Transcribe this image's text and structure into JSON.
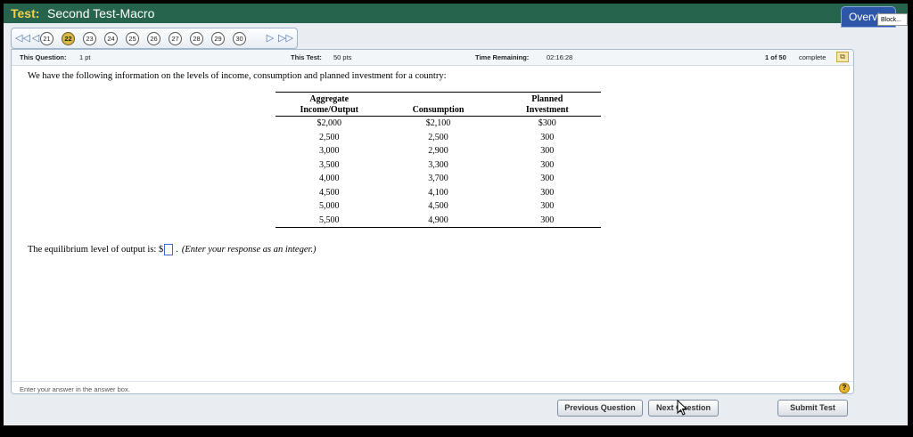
{
  "titlebar": {
    "label": "Test:",
    "title": "Second Test-Macro",
    "overview_label": "Overview",
    "tooltip": "Block..."
  },
  "nav": {
    "questions": [
      {
        "num": "21",
        "current": false
      },
      {
        "num": "22",
        "current": true
      },
      {
        "num": "23",
        "current": false
      },
      {
        "num": "24",
        "current": false
      },
      {
        "num": "25",
        "current": false
      },
      {
        "num": "26",
        "current": false
      },
      {
        "num": "27",
        "current": false
      },
      {
        "num": "28",
        "current": false
      },
      {
        "num": "29",
        "current": false
      },
      {
        "num": "30",
        "current": false
      }
    ]
  },
  "info": {
    "question_label": "This Question:",
    "question_value": "1 pt",
    "test_label": "This Test:",
    "test_value": "50 pts",
    "time_label": "Time Remaining:",
    "time_value": "02:16:28",
    "progress_label": "1 of 50",
    "progress_value": "complete"
  },
  "question": {
    "intro": "We have the following information on the levels of income, consumption and planned investment for a country:",
    "headers": [
      {
        "line1": "Aggregate",
        "line2": "Income/Output"
      },
      {
        "line1": "",
        "line2": "Consumption"
      },
      {
        "line1": "Planned",
        "line2": "Investment"
      }
    ],
    "rows": [
      [
        "$2,000",
        "$2,100",
        "$300"
      ],
      [
        "2,500",
        "2,500",
        "300"
      ],
      [
        "3,000",
        "2,900",
        "300"
      ],
      [
        "3,500",
        "3,300",
        "300"
      ],
      [
        "4,000",
        "3,700",
        "300"
      ],
      [
        "4,500",
        "4,100",
        "300"
      ],
      [
        "5,000",
        "4,500",
        "300"
      ],
      [
        "5,500",
        "4,900",
        "300"
      ]
    ],
    "answer_prefix": "The equilibrium level of output is: $",
    "answer_value": "",
    "answer_suffix": ".",
    "answer_hint": "(Enter your response as an integer.)"
  },
  "footer": {
    "hint": "Enter your answer in the answer box."
  },
  "buttons": {
    "previous": "Previous Question",
    "next": "Next Question",
    "submit": "Submit Test"
  }
}
